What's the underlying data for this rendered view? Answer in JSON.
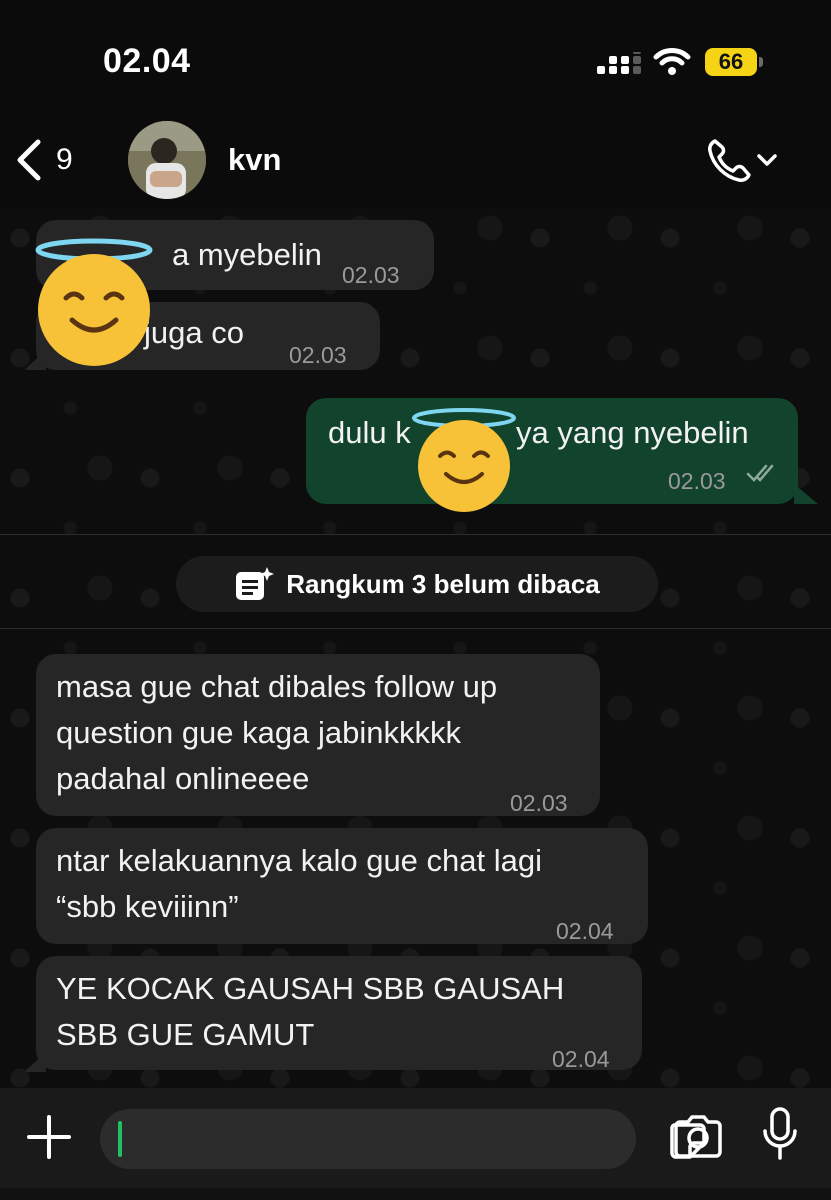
{
  "status_bar": {
    "time": "02.04",
    "battery": "66",
    "battery_color": "#f5d315"
  },
  "header": {
    "unread_count": "9",
    "contact_name": "kvn",
    "back_icon": "chevron-left-icon",
    "call_icon": "phone-icon"
  },
  "messages": [
    {
      "direction": "incoming",
      "text": "a myebelin",
      "time": "02.03",
      "note": "start of text covered by emoji"
    },
    {
      "direction": "incoming",
      "text": "juga co",
      "time": "02.03"
    },
    {
      "direction": "outgoing",
      "text_before": "dulu k",
      "text_after": "ya yang nyebelin",
      "time": "02.03",
      "status": "read"
    },
    {
      "direction": "incoming",
      "lines": [
        "masa gue chat dibales follow up",
        "question gue kaga jabinkkkkk",
        "padahal onlineeee"
      ],
      "time": "02.03"
    },
    {
      "direction": "incoming",
      "lines": [
        "ntar kelakuannya kalo gue chat lagi",
        "“sbb keviiinn”"
      ],
      "time": "02.04"
    },
    {
      "direction": "incoming",
      "lines": [
        "YE KOCAK GAUSAH SBB GAUSAH",
        "SBB GUE GAMUT"
      ],
      "time": "02.04"
    }
  ],
  "summary": {
    "label": "Rangkum 3 belum dibaca",
    "icon": "summary-sparkle-icon"
  },
  "composer": {
    "input_value": "",
    "icons": [
      "plus-icon",
      "sticker-icon",
      "camera-icon",
      "microphone-icon"
    ]
  },
  "colors": {
    "outgoing_bubble": "#12432d",
    "incoming_bubble": "#262626",
    "accent": "#21c063"
  }
}
